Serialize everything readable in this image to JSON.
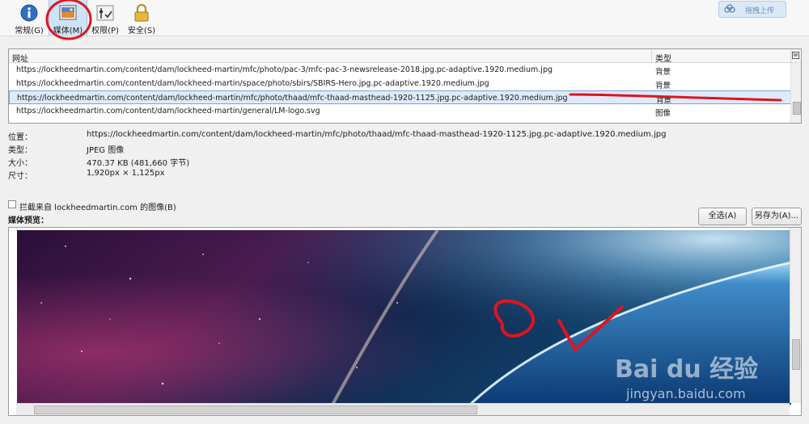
{
  "toolbar": {
    "tabs": [
      {
        "label": "常规(G)",
        "icon": "info-icon"
      },
      {
        "label": "媒体(M)",
        "icon": "media-icon"
      },
      {
        "label": "权限(P)",
        "icon": "permissions-icon"
      },
      {
        "label": "安全(S)",
        "icon": "lock-icon"
      }
    ],
    "upload_label": "拖拽上传"
  },
  "table": {
    "columns": [
      "网址",
      "类型"
    ],
    "rows": [
      {
        "url": "https://lockheedmartin.com/content/dam/lockheed-martin/mfc/photo/pac-3/mfc-pac-3-newsrelease-2018.jpg.pc-adaptive.1920.medium.jpg",
        "type": "背景"
      },
      {
        "url": "https://lockheedmartin.com/content/dam/lockheed-martin/space/photo/sbirs/SBIRS-Hero.jpg.pc-adaptive.1920.medium.jpg",
        "type": "背景"
      },
      {
        "url": "https://lockheedmartin.com/content/dam/lockheed-martin/mfc/photo/thaad/mfc-thaad-masthead-1920-1125.jpg.pc-adaptive.1920.medium.jpg",
        "type": "背景"
      },
      {
        "url": "https://lockheedmartin.com/content/dam/lockheed-martin/general/LM-logo.svg",
        "type": "图像"
      }
    ],
    "selected_index": 2
  },
  "info": {
    "location_label": "位置：",
    "location": "https://lockheedmartin.com/content/dam/lockheed-martin/mfc/photo/thaad/mfc-thaad-masthead-1920-1125.jpg.pc-adaptive.1920.medium.jpg",
    "type_label": "类型：",
    "type": "JPEG 图像",
    "size_label": "大小：",
    "size": "470.37 KB (481,660 字节)",
    "dims_label": "尺寸：",
    "dims": "1,920px × 1,125px"
  },
  "block": {
    "label": "拦截来自 lockheedmartin.com 的图像(B)",
    "checked": false
  },
  "preview_label": "媒体预览：",
  "buttons": {
    "select_all": "全选(A)",
    "save_as": "另存为(A)..."
  },
  "watermark": {
    "logo": "Bai du 经验",
    "url": "jingyan.baidu.com"
  },
  "colors": {
    "selection": "#dfeaf9",
    "annotation": "#e0141e"
  }
}
